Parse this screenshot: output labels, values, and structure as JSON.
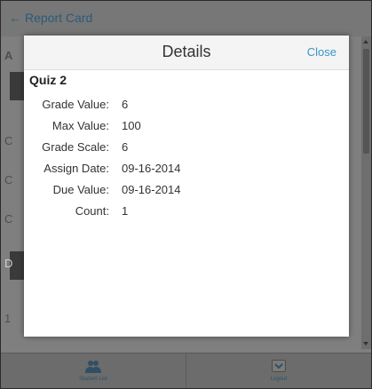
{
  "topbar": {
    "back_label": "Report Card",
    "back_arrow": "←"
  },
  "background": {
    "fragments": [
      "A",
      "C",
      "C",
      "C",
      "D",
      "1"
    ]
  },
  "modal": {
    "title": "Details",
    "close_label": "Close",
    "item_title": "Quiz 2",
    "fields": [
      {
        "label": "Grade Value:",
        "value": "6"
      },
      {
        "label": "Max Value:",
        "value": "100"
      },
      {
        "label": "Grade Scale:",
        "value": "6"
      },
      {
        "label": "Assign Date:",
        "value": "09-16-2014"
      },
      {
        "label": "Due Value:",
        "value": "09-16-2014"
      },
      {
        "label": "Count:",
        "value": "1"
      }
    ]
  },
  "footer": {
    "left_label": "Student List",
    "left_icon": "users-icon",
    "right_label": "Logout",
    "right_icon": "chevron-down-icon"
  },
  "colors": {
    "link": "#3a95c7",
    "overlay": "#7f7f7f"
  }
}
